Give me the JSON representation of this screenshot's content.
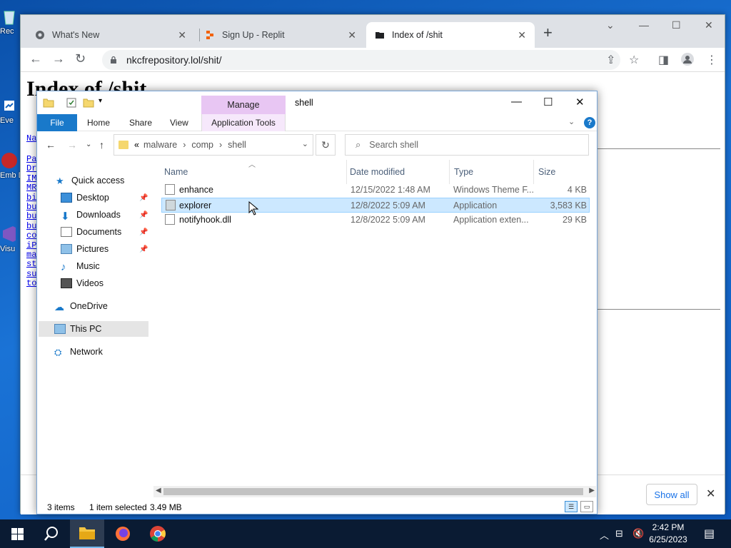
{
  "desktop": {
    "icons": [
      {
        "name": "recycle-bin-icon",
        "label": "Rec"
      },
      {
        "name": "event-icon",
        "label": "Eve"
      },
      {
        "name": "embed-icon",
        "label": "Emb De"
      },
      {
        "name": "visual-studio-icon",
        "label": "Visu"
      }
    ]
  },
  "browser": {
    "tabs": [
      {
        "title": "What's New",
        "active": false
      },
      {
        "title": "Sign Up - Replit",
        "active": false
      },
      {
        "title": "Index of /shit",
        "active": true
      }
    ],
    "url": "nkcfrepository.lol/shit/",
    "page": {
      "heading": "Index of /shit",
      "name_link": "Na",
      "links": [
        "Pa",
        "Dr",
        "IM",
        "MR",
        "bi",
        "bu",
        "bu",
        "bu",
        "co",
        "iP",
        "ma",
        "st",
        "su",
        "to"
      ]
    },
    "download_bar": {
      "show_all": "Show all"
    }
  },
  "explorer": {
    "ribbon_context": "Manage",
    "window_title": "shell",
    "ribbon_tabs": [
      "File",
      "Home",
      "Share",
      "View",
      "Application Tools"
    ],
    "path": [
      "malware",
      "comp",
      "shell"
    ],
    "path_overflow": "«",
    "search_placeholder": "Search shell",
    "nav": {
      "quick_access": "Quick access",
      "items": [
        {
          "label": "Desktop",
          "pinned": true
        },
        {
          "label": "Downloads",
          "pinned": true
        },
        {
          "label": "Documents",
          "pinned": true
        },
        {
          "label": "Pictures",
          "pinned": true
        },
        {
          "label": "Music",
          "pinned": false
        },
        {
          "label": "Videos",
          "pinned": false
        }
      ],
      "onedrive": "OneDrive",
      "this_pc": "This PC",
      "network": "Network"
    },
    "columns": [
      "Name",
      "Date modified",
      "Type",
      "Size"
    ],
    "files": [
      {
        "name": "enhance",
        "date": "12/15/2022 1:48 AM",
        "type": "Windows Theme F...",
        "size": "4 KB",
        "selected": false
      },
      {
        "name": "explorer",
        "date": "12/8/2022 5:09 AM",
        "type": "Application",
        "size": "3,583 KB",
        "selected": true
      },
      {
        "name": "notifyhook.dll",
        "date": "12/8/2022 5:09 AM",
        "type": "Application exten...",
        "size": "29 KB",
        "selected": false
      }
    ],
    "status": {
      "items": "3 items",
      "selected": "1 item selected",
      "size": "3.49 MB"
    }
  },
  "taskbar": {
    "time": "2:42 PM",
    "date": "6/25/2023"
  },
  "colors": {
    "file_tab": "#1979ca",
    "manage": "#e8c6f3",
    "selection": "#cce8ff",
    "taskbar": "#0a1b33"
  }
}
